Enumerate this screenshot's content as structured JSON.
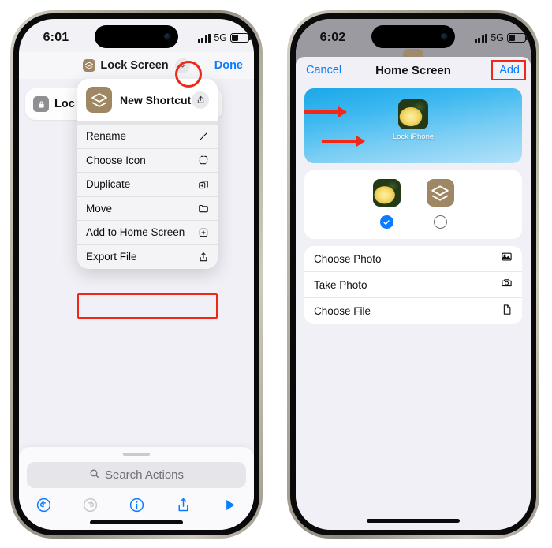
{
  "left_phone": {
    "status": {
      "time": "6:01",
      "network": "5G",
      "signal_bars": 4,
      "battery_level": 38
    },
    "navbar": {
      "icon": "shortcut-layers-icon",
      "title": "Lock Screen",
      "chevron": "chevron-down-icon",
      "done_label": "Done"
    },
    "action_card": {
      "icon": "lock-icon",
      "label": "Loc",
      "close": "close-icon"
    },
    "context_menu": {
      "header": {
        "icon": "shortcut-layers-icon",
        "title": "New Shortcut",
        "action_icon": "share-icon"
      },
      "items": [
        {
          "label": "Rename",
          "icon": "pencil-icon",
          "highlighted": false
        },
        {
          "label": "Choose Icon",
          "icon": "dashed-square-icon",
          "highlighted": false
        },
        {
          "label": "Duplicate",
          "icon": "duplicate-icon",
          "highlighted": false
        },
        {
          "label": "Move",
          "icon": "folder-icon",
          "highlighted": false
        },
        {
          "label": "Add to Home Screen",
          "icon": "plus-square-icon",
          "highlighted": true
        },
        {
          "label": "Export File",
          "icon": "share-icon",
          "highlighted": false
        }
      ]
    },
    "bottom_bar": {
      "search_placeholder": "Search Actions",
      "search_icon": "search-icon",
      "tools": [
        {
          "name": "undo-icon",
          "color": "#0a7cff"
        },
        {
          "name": "redo-icon",
          "color": "#c7c7cc"
        },
        {
          "name": "info-icon",
          "color": "#0a7cff"
        },
        {
          "name": "share-icon",
          "color": "#0a7cff"
        },
        {
          "name": "play-icon",
          "color": "#0a7cff"
        }
      ]
    }
  },
  "right_phone": {
    "status": {
      "time": "6:02",
      "network": "5G",
      "signal_bars": 4,
      "battery_level": 38
    },
    "sheet_nav": {
      "cancel_label": "Cancel",
      "title": "Home Screen",
      "add_label": "Add"
    },
    "preview": {
      "app_label": "Lock iPhone",
      "icon": "photo-thumbnail"
    },
    "icon_picker": {
      "options": [
        {
          "icon": "photo-thumbnail",
          "selected": true
        },
        {
          "icon": "shortcut-layers-icon",
          "selected": false
        }
      ]
    },
    "options_list": [
      {
        "label": "Choose Photo",
        "icon": "photo-icon"
      },
      {
        "label": "Take Photo",
        "icon": "camera-icon"
      },
      {
        "label": "Choose File",
        "icon": "document-icon"
      }
    ]
  },
  "annotations": {
    "accent_color": "#f22717",
    "circle_target": "chevron-down-icon",
    "box_targets": [
      "Add to Home Screen",
      "Add"
    ],
    "arrow_targets": [
      "Lock iPhone",
      "selected-icon-radio"
    ]
  }
}
